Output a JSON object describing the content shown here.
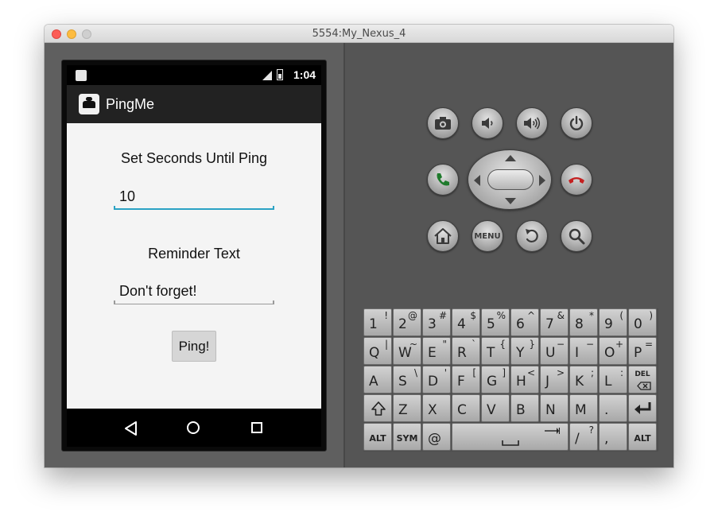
{
  "window": {
    "title": "5554:My_Nexus_4"
  },
  "statusbar": {
    "time": "1:04"
  },
  "app": {
    "title": "PingMe"
  },
  "form": {
    "seconds_label": "Set Seconds Until Ping",
    "seconds_value": "10",
    "reminder_label": "Reminder Text",
    "reminder_value": "Don't forget!",
    "ping_button": "Ping!"
  },
  "hardware_buttons": {
    "menu_label": "MENU"
  },
  "keyboard": {
    "rows": [
      [
        [
          "1",
          "!"
        ],
        [
          "2",
          "@"
        ],
        [
          "3",
          "#"
        ],
        [
          "4",
          "$"
        ],
        [
          "5",
          "%"
        ],
        [
          "6",
          "^"
        ],
        [
          "7",
          "&"
        ],
        [
          "8",
          "*"
        ],
        [
          "9",
          "("
        ],
        [
          "0",
          ")"
        ]
      ],
      [
        [
          "Q",
          "|"
        ],
        [
          "W",
          "~"
        ],
        [
          "E",
          "\""
        ],
        [
          "R",
          "`"
        ],
        [
          "T",
          "{"
        ],
        [
          "Y",
          "}"
        ],
        [
          "U",
          "−"
        ],
        [
          "I",
          "−"
        ],
        [
          "O",
          "+"
        ],
        [
          "P",
          "="
        ]
      ],
      [
        [
          "A",
          ""
        ],
        [
          "S",
          "\\"
        ],
        [
          "D",
          "'"
        ],
        [
          "F",
          "["
        ],
        [
          "G",
          "]"
        ],
        [
          "H",
          "<"
        ],
        [
          "J",
          ">"
        ],
        [
          "K",
          ";"
        ],
        [
          "L",
          ":"
        ],
        [
          "DEL",
          ""
        ]
      ],
      [
        [
          "SHIFT",
          ""
        ],
        [
          "Z",
          ""
        ],
        [
          "X",
          ""
        ],
        [
          "C",
          ""
        ],
        [
          "V",
          ""
        ],
        [
          "B",
          ""
        ],
        [
          "N",
          ""
        ],
        [
          "M",
          ""
        ],
        [
          ".",
          ""
        ],
        [
          "ENTER",
          ""
        ]
      ],
      [
        [
          "ALT",
          ""
        ],
        [
          "SYM",
          ""
        ],
        [
          "@",
          ""
        ],
        [
          "SPACE",
          ""
        ],
        [
          "/",
          "?"
        ],
        [
          ",",
          ""
        ],
        [
          "ALT",
          ""
        ]
      ]
    ]
  }
}
